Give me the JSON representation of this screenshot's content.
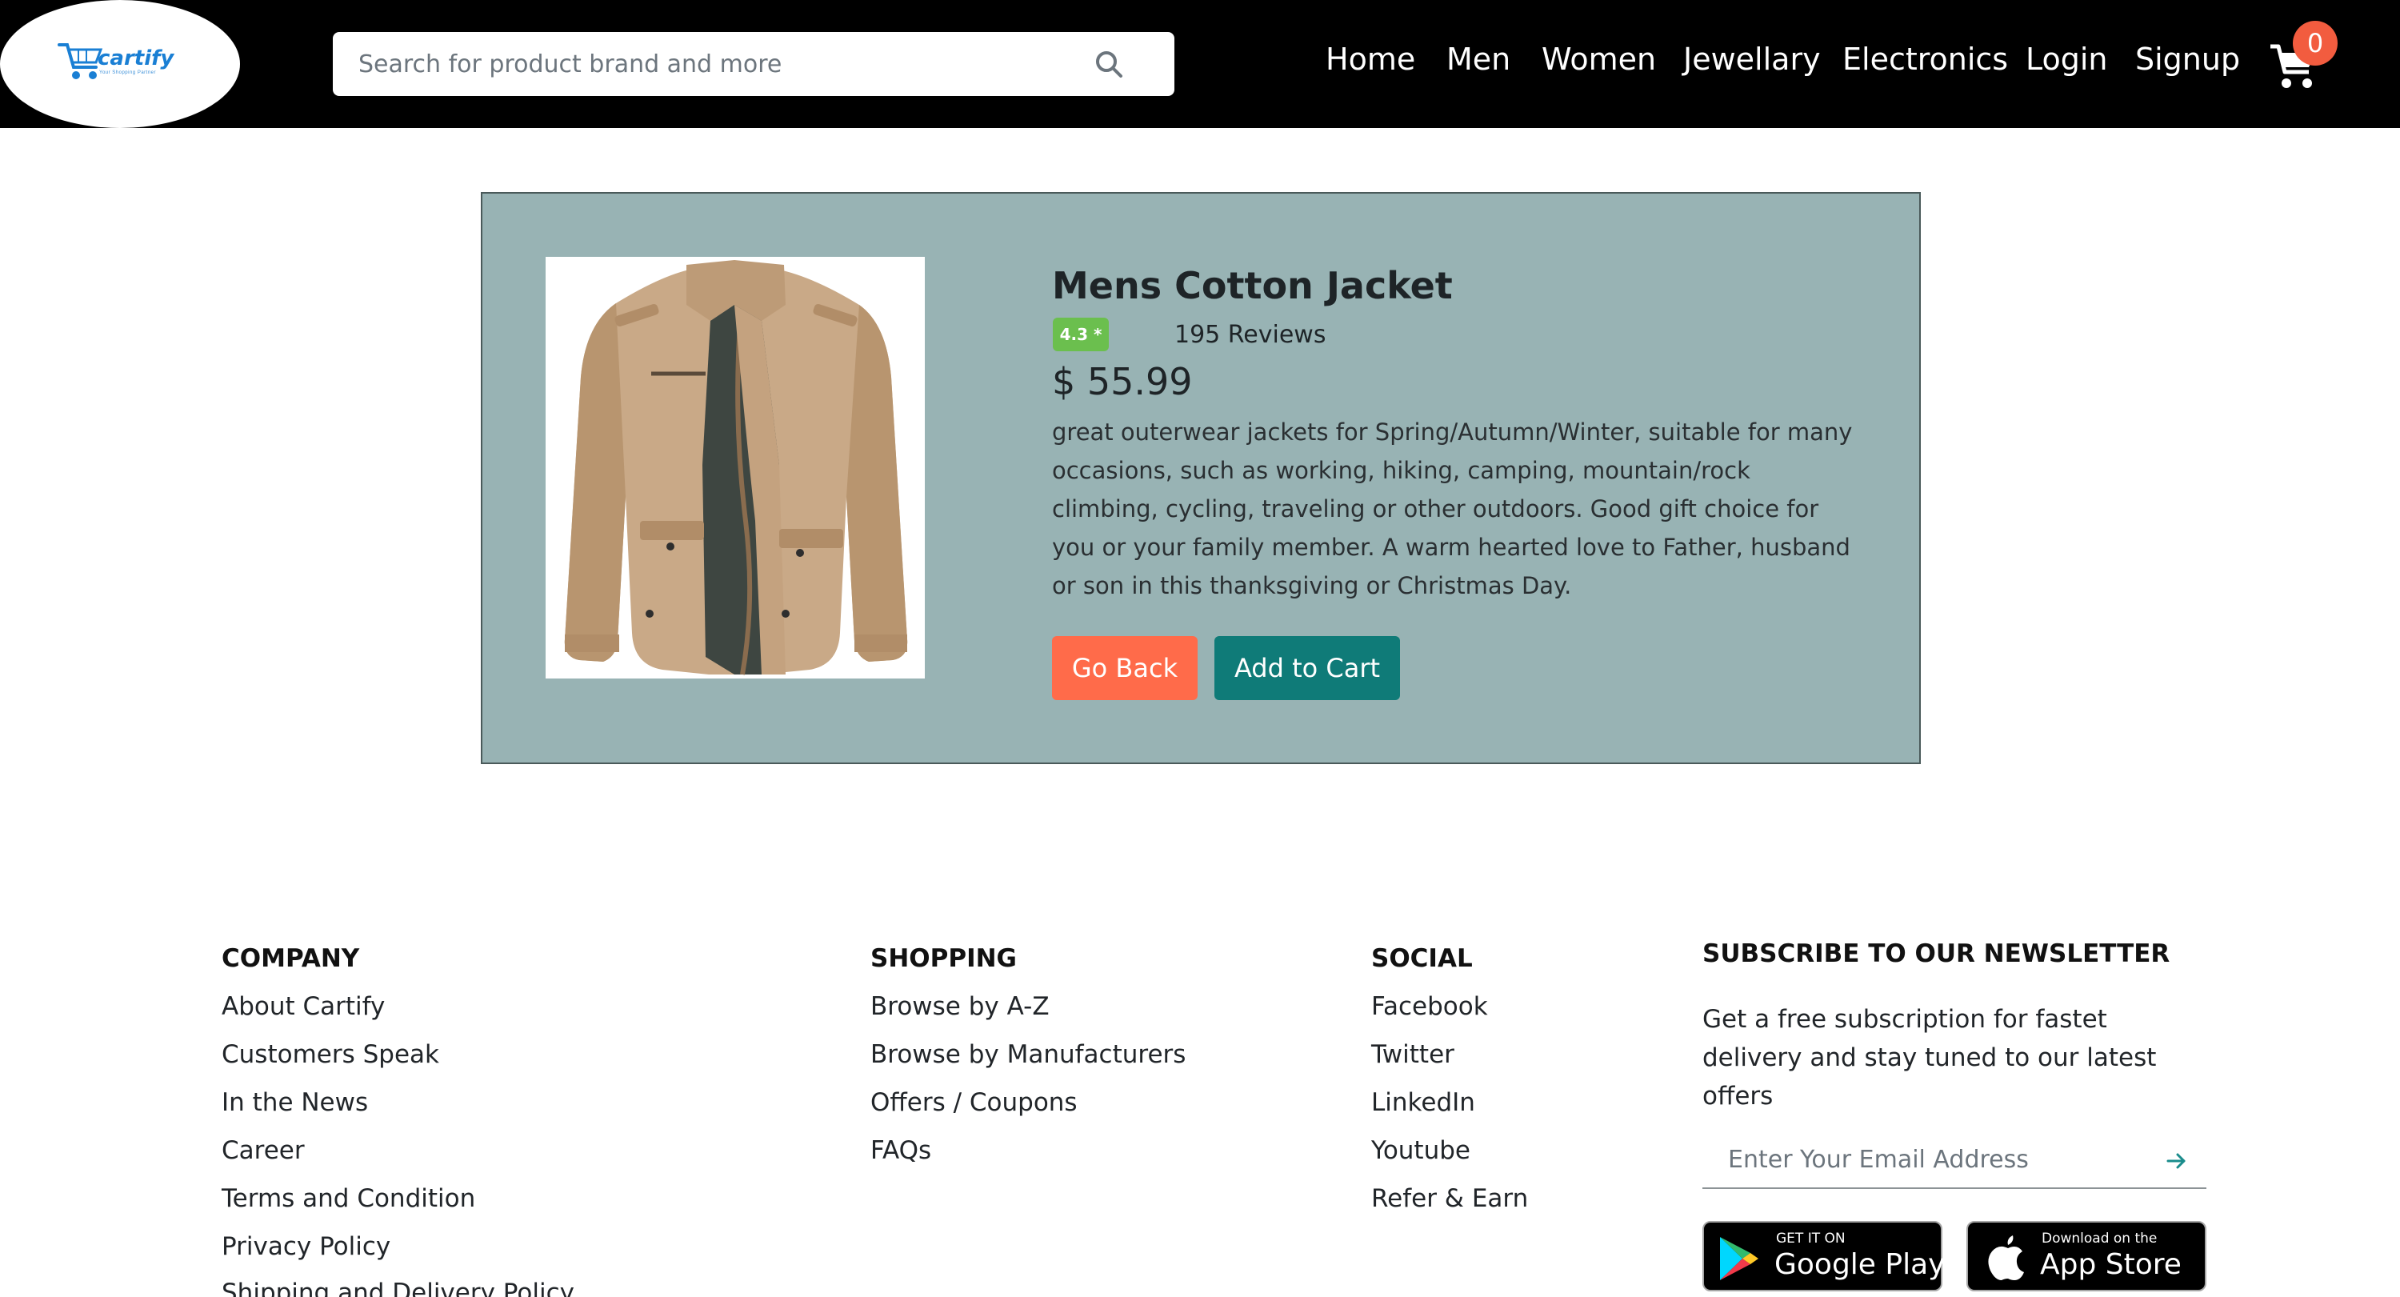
{
  "header": {
    "logo_text": "cartify",
    "logo_tagline": "Your Shopping Partner",
    "search_placeholder": "Search for product brand and more",
    "nav": [
      "Home",
      "Men",
      "Women",
      "Jewellary",
      "Electronics",
      "Login",
      "Signup"
    ],
    "cart_count": "0",
    "colors": {
      "background": "#000000",
      "badge": "#f25c3f"
    }
  },
  "product": {
    "title": "Mens Cotton Jacket",
    "rating": "4.3 *",
    "reviews": "195 Reviews",
    "price": "$ 55.99",
    "description": "great outerwear jackets for Spring/Autumn/Winter, suitable for many occasions, such as working, hiking, camping, mountain/rock climbing, cycling, traveling or other outdoors. Good gift choice for you or your family member. A warm hearted love to Father, husband or son in this thanksgiving or Christmas Day.",
    "back_label": "Go Back",
    "add_label": "Add to Cart",
    "image_icon": "jacket-image",
    "colors": {
      "card": "#98b3b4",
      "back": "#ff6b4a",
      "add": "#0f7b78",
      "rating": "#6bbf4e"
    }
  },
  "footer": {
    "company": {
      "heading": "COMPANY",
      "links": [
        "About Cartify",
        "Customers Speak",
        "In the News",
        "Career",
        "Terms and Condition",
        "Privacy Policy",
        "Shipping and Delivery Policy"
      ]
    },
    "shopping": {
      "heading": "SHOPPING",
      "links": [
        "Browse by A-Z",
        "Browse by Manufacturers",
        "Offers / Coupons",
        "FAQs"
      ]
    },
    "social": {
      "heading": "SOCIAL",
      "links": [
        "Facebook",
        "Twitter",
        "LinkedIn",
        "Youtube",
        "Refer & Earn"
      ]
    },
    "newsletter": {
      "heading": "SUBSCRIBE TO OUR NEWSLETTER",
      "text": "Get a free subscription for fastet delivery and stay tuned to our latest offers",
      "email_placeholder": "Enter Your Email Address"
    },
    "stores": {
      "google_small": "GET IT ON",
      "google_big": "Google Play",
      "apple_small": "Download on the",
      "apple_big": "App Store"
    }
  }
}
